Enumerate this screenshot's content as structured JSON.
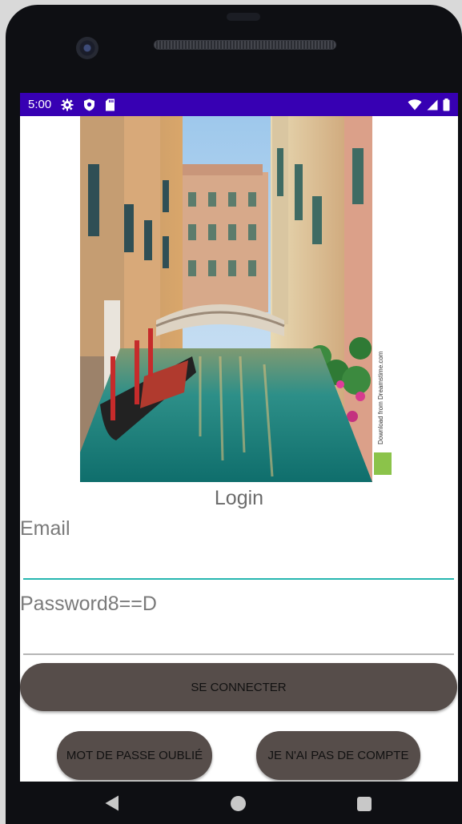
{
  "status_bar": {
    "time": "5:00",
    "left_icons": [
      "settings-gear-icon",
      "shield-icon",
      "sd-card-icon"
    ],
    "right_icons": [
      "wifi-icon",
      "cellular-signal-icon",
      "battery-icon"
    ],
    "color": "#3700b3"
  },
  "image": {
    "watermark": "Download from Dreamstime.com"
  },
  "login": {
    "title": "Login",
    "email_label": "Email",
    "password_label": "Password8==D"
  },
  "buttons": {
    "connect": "SE CONNECTER",
    "forgot_password": "MOT DE PASSE OUBLIÉ",
    "no_account": "JE N'AI PAS DE COMPTE",
    "color": "#564d4a"
  },
  "navigation": {
    "items": [
      "back-icon",
      "home-icon",
      "recents-icon"
    ]
  },
  "colors": {
    "email_underline": "#26b6b0",
    "password_underline": "#b5b5b5"
  }
}
